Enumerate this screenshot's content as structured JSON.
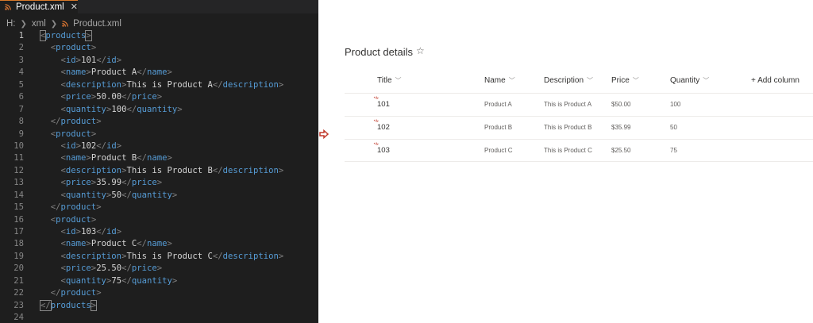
{
  "editor": {
    "tab_label": "Product.xml",
    "breadcrumb": [
      "H:",
      "xml",
      "Product.xml"
    ],
    "line_numbers": [
      "1",
      "2",
      "3",
      "4",
      "5",
      "6",
      "7",
      "8",
      "9",
      "10",
      "11",
      "12",
      "13",
      "14",
      "15",
      "16",
      "17",
      "18",
      "19",
      "20",
      "21",
      "22",
      "23",
      "24"
    ]
  },
  "list": {
    "title": "Product details",
    "columns": [
      "Title",
      "Name",
      "Description",
      "Price",
      "Quantity"
    ],
    "add_column_label": "+ Add column",
    "rows": [
      {
        "title": "101",
        "name": "Product A",
        "description": "This is Product A",
        "price": "$50.00",
        "quantity": "100"
      },
      {
        "title": "102",
        "name": "Product B",
        "description": "This is Product B",
        "price": "$35.99",
        "quantity": "50"
      },
      {
        "title": "103",
        "name": "Product C",
        "description": "This is Product C",
        "price": "$25.50",
        "quantity": "75"
      }
    ]
  },
  "colors": {
    "tag": "#569cd6",
    "bracket": "#808080",
    "text": "#d4d4d4",
    "accent_red": "#c0392b"
  }
}
